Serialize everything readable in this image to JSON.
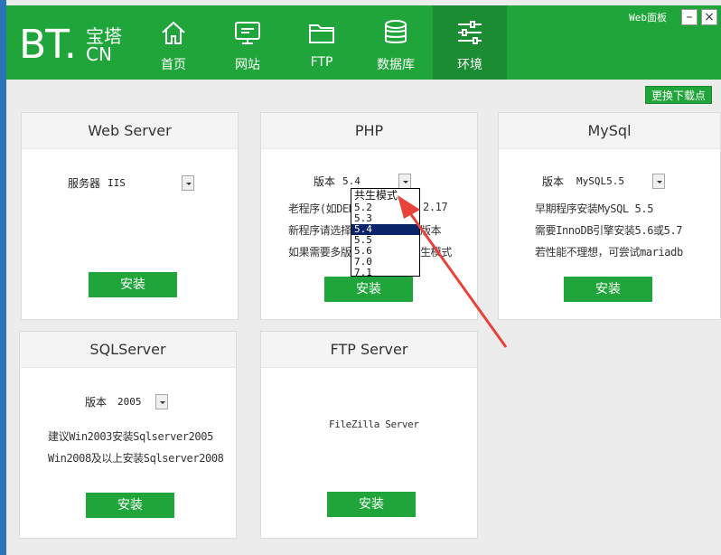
{
  "window": {
    "title": "Web面板",
    "min_label": "–",
    "close_label": "×"
  },
  "logo": {
    "main": "BT.",
    "cn_top": "宝塔",
    "cn_bottom": "CN"
  },
  "nav": [
    {
      "label": "首页",
      "icon": "home-icon",
      "active": false
    },
    {
      "label": "网站",
      "icon": "monitor-icon",
      "active": false
    },
    {
      "label": "FTP",
      "icon": "folder-icon",
      "active": false
    },
    {
      "label": "数据库",
      "icon": "database-icon",
      "active": false
    },
    {
      "label": "环境",
      "icon": "sliders-icon",
      "active": true
    }
  ],
  "change_source_label": "更换下载点",
  "cards": {
    "webserver": {
      "title": "Web Server",
      "select_label": "服务器",
      "select_value": "IIS",
      "install_label": "安装"
    },
    "php": {
      "title": "PHP",
      "select_label": "版本",
      "select_value": "5.4",
      "notes": [
        "老程序(如DEDE",
        "2.17",
        "新程序请选择",
        "版本",
        "如果需要多版",
        "生模式"
      ],
      "install_label": "安装",
      "dropdown_options": [
        "共生模式",
        "5.2",
        "5.3",
        "5.4",
        "5.5",
        "5.6",
        "7.0",
        "7.1"
      ],
      "dropdown_selected": "5.4"
    },
    "mysql": {
      "title": "MySql",
      "select_label": "版本",
      "select_value": "MySQL5.5",
      "notes": [
        "早期程序安装MySQL 5.5",
        "需要InnoDB引擎安装5.6或5.7",
        "若性能不理想，可尝试mariadb"
      ],
      "install_label": "安装"
    },
    "sqlserver": {
      "title": "SQLServer",
      "select_label": "版本",
      "select_value": "2005",
      "notes": [
        "建议Win2003安装Sqlserver2005",
        "Win2008及以上安装Sqlserver2008"
      ],
      "install_label": "安装"
    },
    "ftpserver": {
      "title": "FTP Server",
      "note": "FileZilla Server",
      "install_label": "安装"
    }
  },
  "colors": {
    "brand_green": "#20a53a",
    "active_green": "#1b8c31",
    "annotation_red": "#e8423a",
    "select_highlight": "#0a246a"
  }
}
